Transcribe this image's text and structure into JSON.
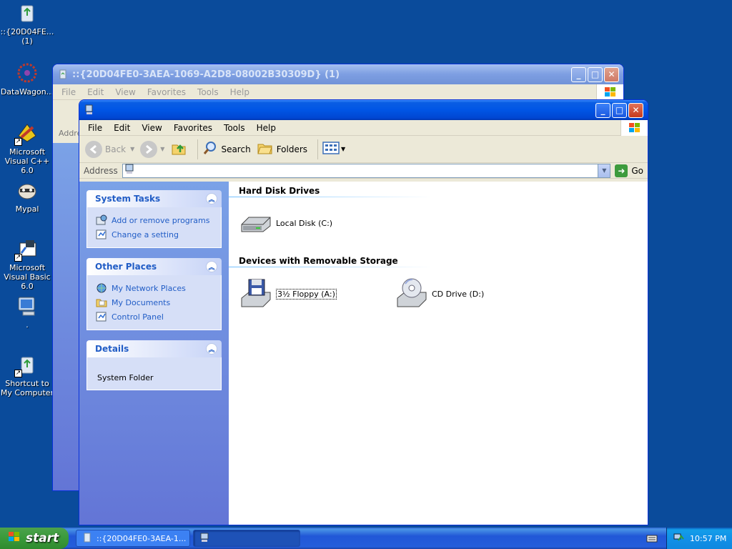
{
  "desktop": {
    "icons": [
      {
        "label": "::{20D04FE...\n(1)"
      },
      {
        "label": "DataWagon..."
      },
      {
        "label": "Microsoft Visual C++ 6.0"
      },
      {
        "label": "Mypal"
      },
      {
        "label": "Microsoft Visual Basic 6.0"
      },
      {
        "label": "."
      },
      {
        "label": "Shortcut to My Computer"
      }
    ]
  },
  "back_window": {
    "title": "::{20D04FE0-3AEA-1069-A2D8-08002B30309D} (1)",
    "menu": [
      "File",
      "Edit",
      "View",
      "Favorites",
      "Tools",
      "Help"
    ],
    "address_label": "Addre"
  },
  "front_window": {
    "title": "",
    "menu": [
      "File",
      "Edit",
      "View",
      "Favorites",
      "Tools",
      "Help"
    ],
    "toolbar": {
      "back": "Back",
      "search": "Search",
      "folders": "Folders"
    },
    "address": {
      "label": "Address",
      "value": "",
      "go": "Go"
    },
    "panels": {
      "system_tasks": {
        "title": "System Tasks",
        "items": [
          "Add or remove programs",
          "Change a setting"
        ]
      },
      "other_places": {
        "title": "Other Places",
        "items": [
          "My Network Places",
          "My Documents",
          "Control Panel"
        ]
      },
      "details": {
        "title": "Details",
        "text": "System Folder"
      }
    },
    "groups": {
      "hard_disks": {
        "title": "Hard Disk Drives",
        "drives": [
          "Local Disk (C:)"
        ]
      },
      "removable": {
        "title": "Devices with Removable Storage",
        "drives": [
          "3½ Floppy (A:)",
          "CD Drive (D:)"
        ]
      }
    }
  },
  "taskbar": {
    "start": "start",
    "tasks": [
      "::{20D04FE0-3AEA-1...",
      ""
    ],
    "clock": "10:57 PM"
  }
}
